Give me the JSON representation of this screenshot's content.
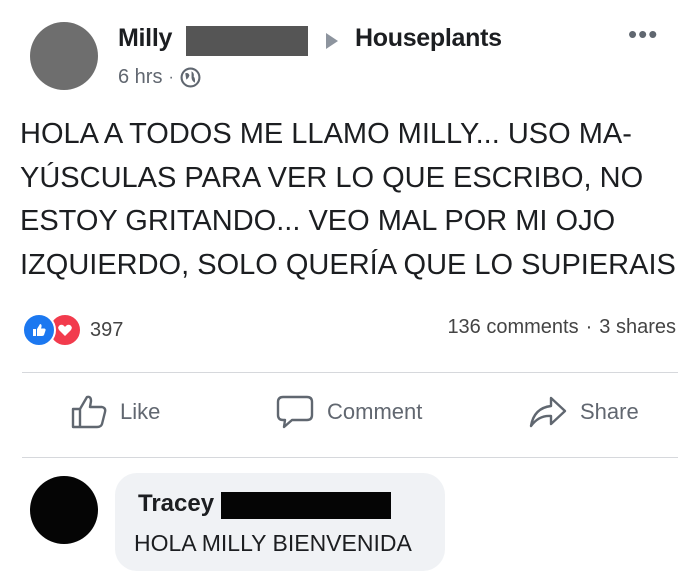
{
  "post": {
    "author": "Milly",
    "group": "Houseplants",
    "time": "6 hrs",
    "separator": "·",
    "more_icon": "more-horizontal-icon",
    "text_lines": [
      "HOLA A TODOS ME LLAMO MILLY... USO MA-",
      "YÚSCULAS PARA VER LO QUE ESCRIBO, NO",
      "ESTOY GRITANDO... VEO MAL POR MI OJO",
      "IZQUIERDO, SOLO QUERÍA QUE LO SUPIERAIS"
    ]
  },
  "reactions": {
    "count": "397",
    "comments": "136 comments",
    "shares": "3 shares",
    "separator": "·"
  },
  "actions": {
    "like_label": "Like",
    "comment_label": "Comment",
    "share_label": "Share"
  },
  "comment": {
    "author": "Tracey",
    "text": "HOLA MILLY BIENVENIDA"
  },
  "colors": {
    "like_blue": "#1c78f0",
    "love_red": "#f23b4d",
    "muted_text": "#616770",
    "bubble_bg": "#f0f2f5"
  }
}
